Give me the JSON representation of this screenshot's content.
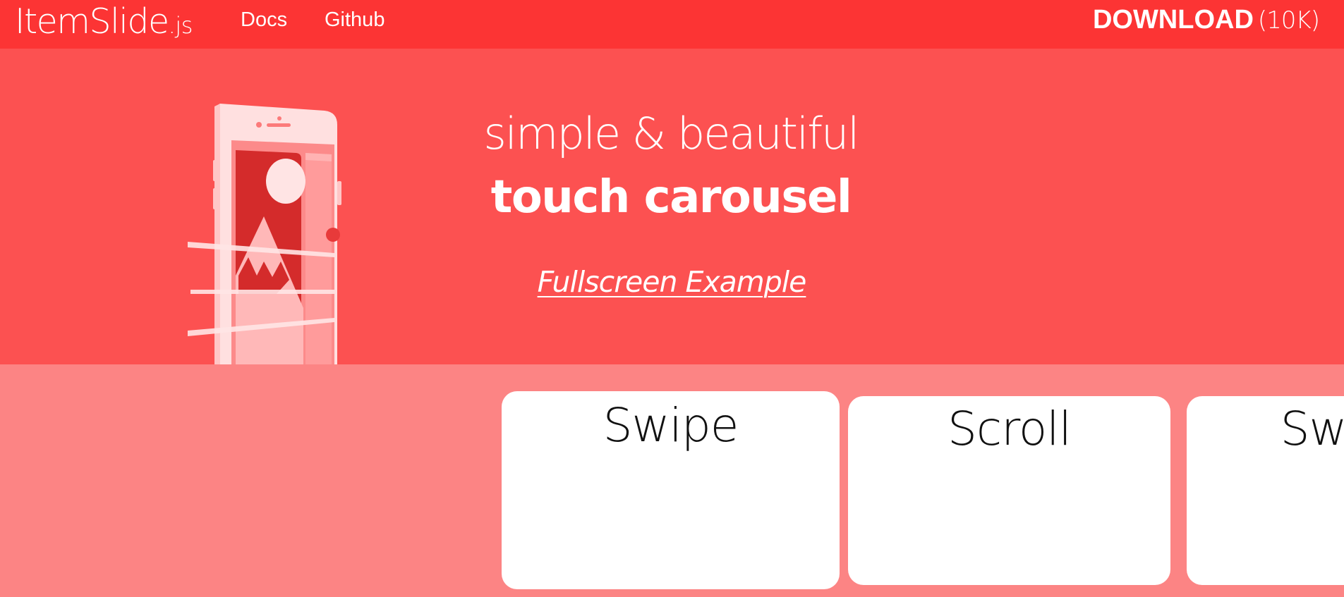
{
  "colors": {
    "header_bg": "#FC3434",
    "hero_bg": "#FC5151",
    "carousel_bg": "#FC8484",
    "card_bg": "#FFFFFF",
    "text_on_red": "#FFFFFF",
    "card_text": "#111111"
  },
  "header": {
    "brand_main": "ItemSlide",
    "brand_ext": ".js",
    "nav": [
      {
        "label": "Docs"
      },
      {
        "label": "Github"
      }
    ],
    "download": {
      "label": "DOWNLOAD",
      "size": "(10K)"
    }
  },
  "hero": {
    "illustration_icon": "phone-carousel-illustration",
    "tagline_line1": "simple & beautiful",
    "tagline_line2": "touch carousel",
    "fullscreen_link": "Fullscreen Example"
  },
  "carousel": {
    "cards": [
      {
        "title": "Swipe"
      },
      {
        "title": "Scroll"
      },
      {
        "title": "Swipe"
      }
    ]
  }
}
